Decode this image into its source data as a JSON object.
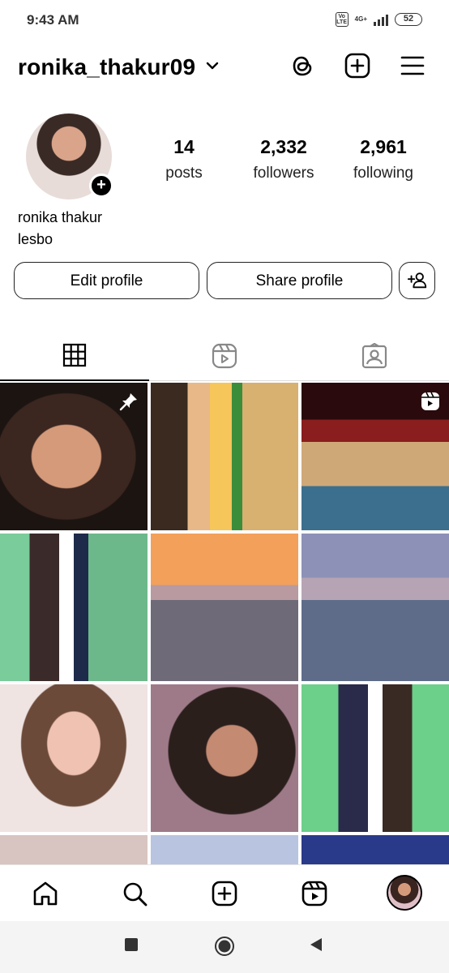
{
  "status_bar": {
    "time": "9:43 AM",
    "volte": "Vo LTE",
    "network": "4G+",
    "battery": "52"
  },
  "header": {
    "username": "ronika_thakur09",
    "icons": [
      "threads-icon",
      "create-post-icon",
      "menu-icon"
    ]
  },
  "profile": {
    "stats": [
      {
        "value": "14",
        "label": "posts"
      },
      {
        "value": "2,332",
        "label": "followers"
      },
      {
        "value": "2,961",
        "label": "following"
      }
    ],
    "full_name": "ronika thakur",
    "bio": "lesbo"
  },
  "buttons": {
    "edit": "Edit profile",
    "share": "Share profile"
  },
  "tabs": [
    "grid",
    "reels",
    "tagged"
  ],
  "grid_photos": [
    {
      "badge": "pin-icon"
    },
    {
      "badge": ""
    },
    {
      "badge": "reel-icon"
    },
    {
      "badge": ""
    },
    {
      "badge": ""
    },
    {
      "badge": ""
    },
    {
      "badge": ""
    },
    {
      "badge": ""
    },
    {
      "badge": ""
    },
    {
      "badge": ""
    },
    {
      "badge": ""
    },
    {
      "badge": ""
    }
  ],
  "bottom_nav": [
    "home-icon",
    "search-icon",
    "create-icon",
    "reels-icon",
    "profile-avatar"
  ],
  "colors": {
    "text": "#000000",
    "border": "#222222",
    "background": "#ffffff"
  }
}
